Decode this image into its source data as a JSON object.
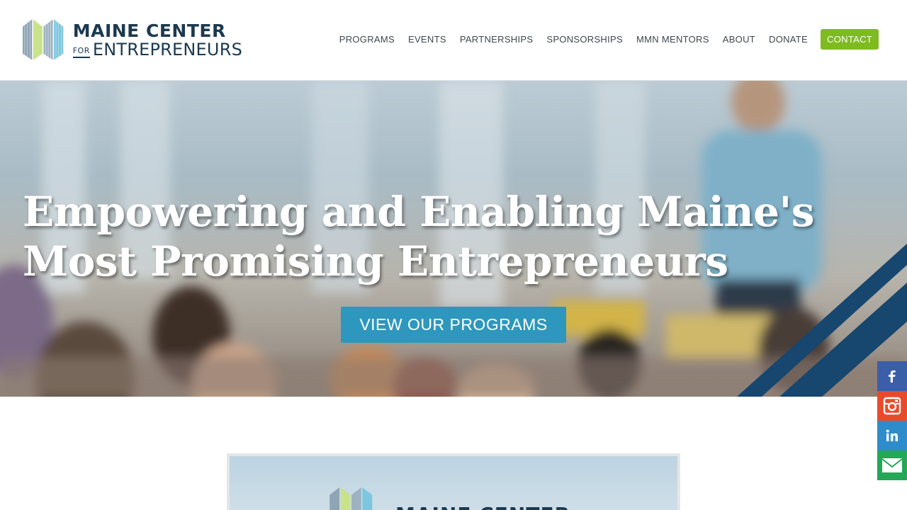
{
  "header": {
    "logo": {
      "line1": "MAINE CENTER",
      "line2_small": "FOR",
      "line2_big": "ENTREPRENEURS"
    },
    "nav": [
      {
        "label": "PROGRAMS"
      },
      {
        "label": "EVENTS"
      },
      {
        "label": "PARTNERSHIPS"
      },
      {
        "label": "SPONSORSHIPS"
      },
      {
        "label": "MMN MENTORS"
      },
      {
        "label": "ABOUT"
      },
      {
        "label": "DONATE"
      }
    ],
    "contact_label": "CONTACT"
  },
  "hero": {
    "title": "Empowering and Enabling Maine's Most Promising Entrepreneurs",
    "button_label": "VIEW OUR PROGRAMS"
  },
  "social": {
    "icons": [
      "facebook-icon",
      "instagram-icon",
      "linkedin-icon",
      "email-icon"
    ]
  },
  "card": {
    "logo_text": "MAINE CENTER"
  },
  "colors": {
    "contact_green": "#7dbb1f",
    "cta_blue": "#2e97bd",
    "brand_navy": "#1c3a4f",
    "facebook": "#3b5ea8",
    "instagram": "#e94b2a",
    "linkedin": "#2f8ccb",
    "email": "#24a757"
  }
}
